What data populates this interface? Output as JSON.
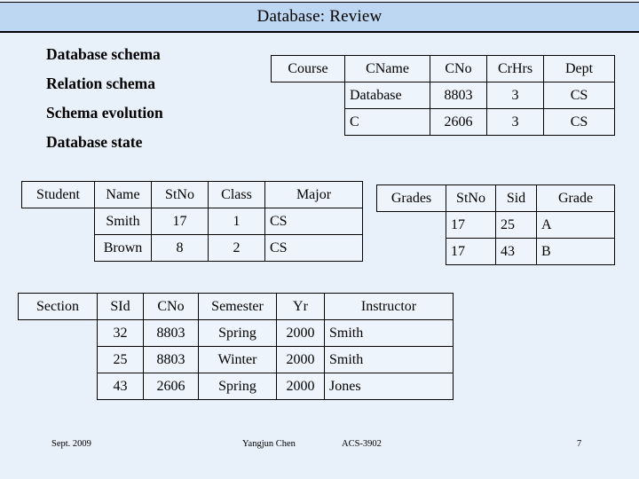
{
  "slide": {
    "title": "Database: Review",
    "title_bar_color": "#bdd7f2",
    "background_color": "#e8f0fa"
  },
  "bullets": [
    {
      "label": "Database schema"
    },
    {
      "label": "Relation schema"
    },
    {
      "label": "Schema evolution"
    },
    {
      "label": "Database state"
    }
  ],
  "tables": {
    "course": {
      "relation_name": "Course",
      "columns": [
        "CName",
        "CNo",
        "CrHrs",
        "Dept"
      ],
      "rows": [
        [
          "Database",
          "8803",
          "3",
          "CS"
        ],
        [
          "C",
          "2606",
          "3",
          "CS"
        ]
      ]
    },
    "student": {
      "relation_name": "Student",
      "columns": [
        "Name",
        "StNo",
        "Class",
        "Major"
      ],
      "rows": [
        [
          "Smith",
          "17",
          "1",
          "CS"
        ],
        [
          "Brown",
          "8",
          "2",
          "CS"
        ]
      ]
    },
    "grades": {
      "relation_name": "Grades",
      "columns": [
        "StNo",
        "Sid",
        "Grade"
      ],
      "rows": [
        [
          "17",
          "25",
          "A"
        ],
        [
          "17",
          "43",
          "B"
        ]
      ]
    },
    "section": {
      "relation_name": "Section",
      "columns": [
        "SId",
        "CNo",
        "Semester",
        "Yr",
        "Instructor"
      ],
      "rows": [
        [
          "32",
          "8803",
          "Spring",
          "2000",
          "Smith"
        ],
        [
          "25",
          "8803",
          "Winter",
          "2000",
          "Smith"
        ],
        [
          "43",
          "2606",
          "Spring",
          "2000",
          "Jones"
        ]
      ]
    }
  },
  "footer": {
    "date": "Sept. 2009",
    "author": "Yangjun Chen",
    "course_code": "ACS-3902",
    "page_number": "7"
  }
}
